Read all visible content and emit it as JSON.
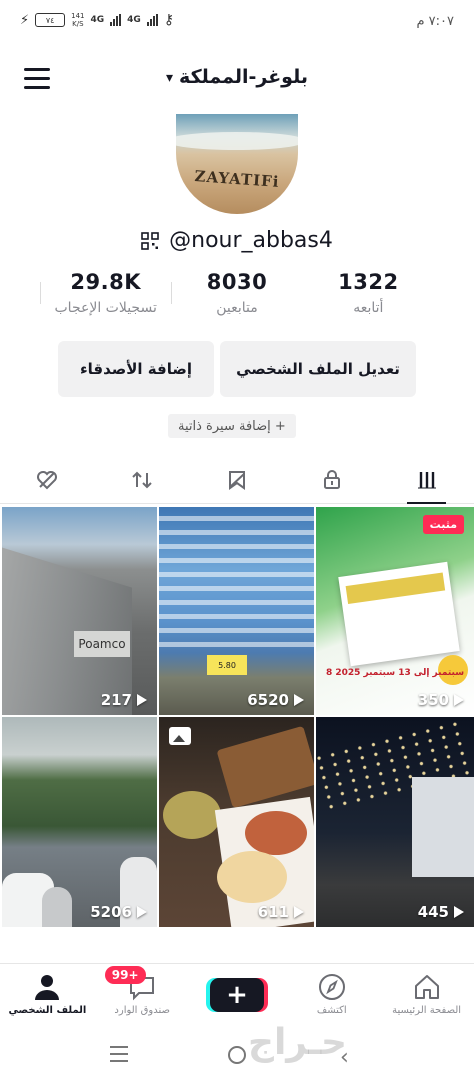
{
  "status_bar": {
    "time": "٧:٠٧ م",
    "network_speed_value": "141",
    "network_speed_unit": "K/S",
    "sim1": "4G",
    "sim2": "4G",
    "battery_level": "٧٤"
  },
  "header": {
    "account_name": "بلوغر-المملكة"
  },
  "profile": {
    "avatar_text": "ZAYATIFi",
    "username": "@nour_abbas4"
  },
  "stats": [
    {
      "value": "1322",
      "label": "أتابعه"
    },
    {
      "value": "8030",
      "label": "متابعين"
    },
    {
      "value": "29.8K",
      "label": "تسجيلات الإعجاب"
    }
  ],
  "buttons": {
    "edit_profile": "تعديل الملف الشخصي",
    "add_friends": "إضافة الأصدقاء",
    "add_bio": "+ إضافة سيرة ذاتية"
  },
  "tabs": [
    {
      "icon": "grid-icon",
      "active": true
    },
    {
      "icon": "lock-icon",
      "active": false
    },
    {
      "icon": "bookmark-hidden-icon",
      "active": false
    },
    {
      "icon": "repost-icon",
      "active": false
    },
    {
      "icon": "liked-hidden-icon",
      "active": false
    }
  ],
  "videos": [
    {
      "views": "217"
    },
    {
      "views": "6520",
      "price_tag": "5.80"
    },
    {
      "views": "350",
      "pinned": "مثبت",
      "flyer_date": "8 سبتمبر إلى 13 سبتمبر 2025"
    },
    {
      "views": "5206"
    },
    {
      "views": "611"
    },
    {
      "views": "445"
    }
  ],
  "bottom_nav": {
    "home": "الصفحة الرئيسية",
    "discover": "اكتشف",
    "create": "+",
    "inbox": "صندوق الوارد",
    "inbox_badge": "99+",
    "profile": "الملف الشخصي"
  },
  "colors": {
    "accent_red": "#fe2c55",
    "accent_cyan": "#25f4ee",
    "text_primary": "#161823",
    "text_secondary": "#8a8b91"
  }
}
